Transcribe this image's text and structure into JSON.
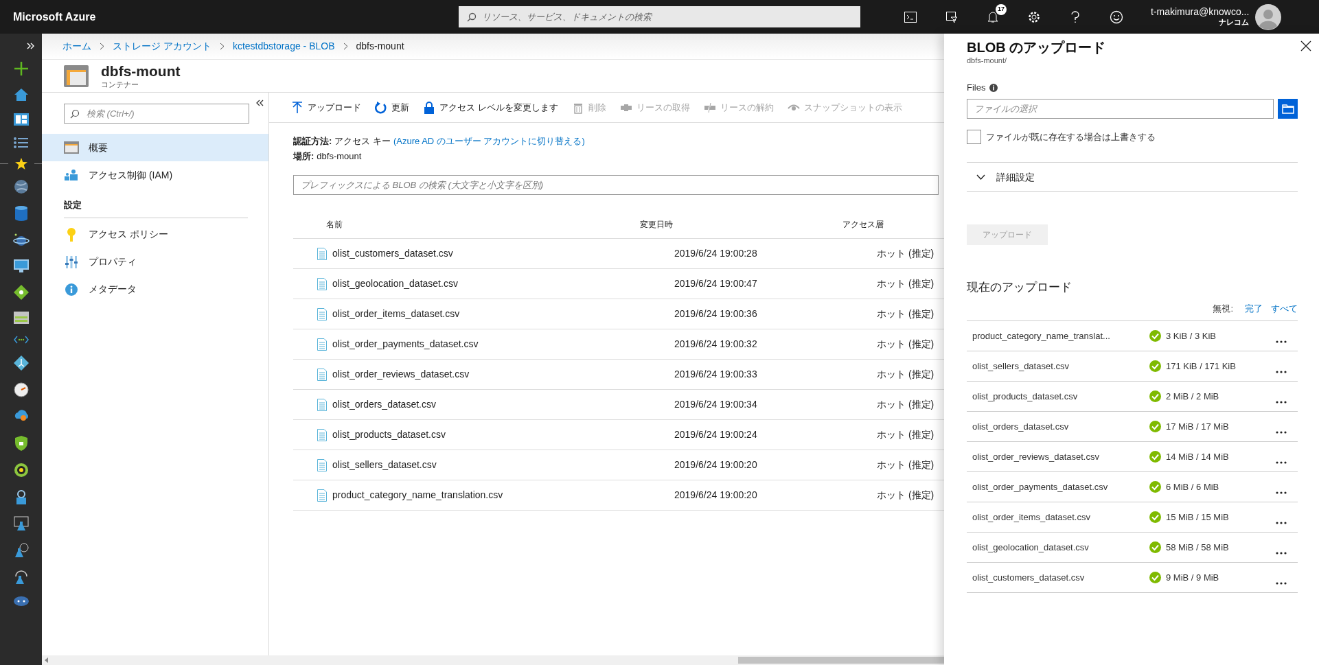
{
  "topbar": {
    "brand": "Microsoft Azure",
    "search_placeholder": "リソース、サービス、ドキュメントの検索",
    "notification_count": "17",
    "user_name": "t-makimura@knowco...",
    "user_org": "ナレコム"
  },
  "breadcrumb": [
    {
      "label": "ホーム",
      "kind": "link"
    },
    {
      "label": "ストレージ アカウント",
      "kind": "link"
    },
    {
      "label": "kctestdbstorage - BLOB",
      "kind": "link"
    },
    {
      "label": "dbfs-mount",
      "kind": "current"
    }
  ],
  "header": {
    "title": "dbfs-mount",
    "subtitle": "コンテナー"
  },
  "nav": {
    "search_placeholder": "検索 (Ctrl+/)",
    "items": [
      {
        "label": "概要",
        "selected": true
      },
      {
        "label": "アクセス制御 (IAM)",
        "selected": false
      }
    ],
    "section": "設定",
    "section_items": [
      {
        "label": "アクセス ポリシー",
        "selected": false
      },
      {
        "label": "プロパティ",
        "selected": false
      },
      {
        "label": "メタデータ",
        "selected": false
      }
    ]
  },
  "toolbar": [
    {
      "label": "アップロード",
      "disabled": false
    },
    {
      "label": "更新",
      "disabled": false
    },
    {
      "label": "アクセス レベルを変更します",
      "disabled": false
    },
    {
      "label": "削除",
      "disabled": true
    },
    {
      "label": "リースの取得",
      "disabled": true
    },
    {
      "label": "リースの解約",
      "disabled": true
    },
    {
      "label": "スナップショットの表示",
      "disabled": true
    }
  ],
  "auth": {
    "label": "認証方法:",
    "value": "アクセス キー",
    "link": "(Azure AD のユーザー アカウントに切り替える)"
  },
  "location": {
    "label": "場所:",
    "value": "dbfs-mount"
  },
  "blob_search_placeholder": "プレフィックスによる BLOB の検索 (大文字と小文字を区別)",
  "table": {
    "columns": [
      "名前",
      "変更日時",
      "アクセス層"
    ],
    "rows": [
      {
        "name": "olist_customers_dataset.csv",
        "modified": "2019/6/24 19:00:28",
        "tier": "ホット (推定)"
      },
      {
        "name": "olist_geolocation_dataset.csv",
        "modified": "2019/6/24 19:00:47",
        "tier": "ホット (推定)"
      },
      {
        "name": "olist_order_items_dataset.csv",
        "modified": "2019/6/24 19:00:36",
        "tier": "ホット (推定)"
      },
      {
        "name": "olist_order_payments_dataset.csv",
        "modified": "2019/6/24 19:00:32",
        "tier": "ホット (推定)"
      },
      {
        "name": "olist_order_reviews_dataset.csv",
        "modified": "2019/6/24 19:00:33",
        "tier": "ホット (推定)"
      },
      {
        "name": "olist_orders_dataset.csv",
        "modified": "2019/6/24 19:00:34",
        "tier": "ホット (推定)"
      },
      {
        "name": "olist_products_dataset.csv",
        "modified": "2019/6/24 19:00:24",
        "tier": "ホット (推定)"
      },
      {
        "name": "olist_sellers_dataset.csv",
        "modified": "2019/6/24 19:00:20",
        "tier": "ホット (推定)"
      },
      {
        "name": "product_category_name_translation.csv",
        "modified": "2019/6/24 19:00:20",
        "tier": "ホット (推定)"
      }
    ]
  },
  "panel": {
    "title": "BLOB のアップロード",
    "subtitle": "dbfs-mount/",
    "files_label": "Files",
    "file_placeholder": "ファイルの選択",
    "overwrite_label": "ファイルが既に存在する場合は上書きする",
    "overwrite_checked": false,
    "advanced_label": "詳細設定",
    "advanced_expanded": false,
    "upload_button": "アップロード",
    "upload_disabled": true,
    "current_heading": "現在のアップロード",
    "ignore_label": "無視:",
    "ignore_links": [
      "完了",
      "すべて"
    ],
    "uploads": [
      {
        "name": "product_category_name_translat...",
        "size": "3 KiB / 3 KiB"
      },
      {
        "name": "olist_sellers_dataset.csv",
        "size": "171 KiB / 171 KiB"
      },
      {
        "name": "olist_products_dataset.csv",
        "size": "2 MiB / 2 MiB"
      },
      {
        "name": "olist_orders_dataset.csv",
        "size": "17 MiB / 17 MiB"
      },
      {
        "name": "olist_order_reviews_dataset.csv",
        "size": "14 MiB / 14 MiB"
      },
      {
        "name": "olist_order_payments_dataset.csv",
        "size": "6 MiB / 6 MiB"
      },
      {
        "name": "olist_order_items_dataset.csv",
        "size": "15 MiB / 15 MiB"
      },
      {
        "name": "olist_geolocation_dataset.csv",
        "size": "58 MiB / 58 MiB"
      },
      {
        "name": "olist_customers_dataset.csv",
        "size": "9 MiB / 9 MiB"
      }
    ]
  }
}
